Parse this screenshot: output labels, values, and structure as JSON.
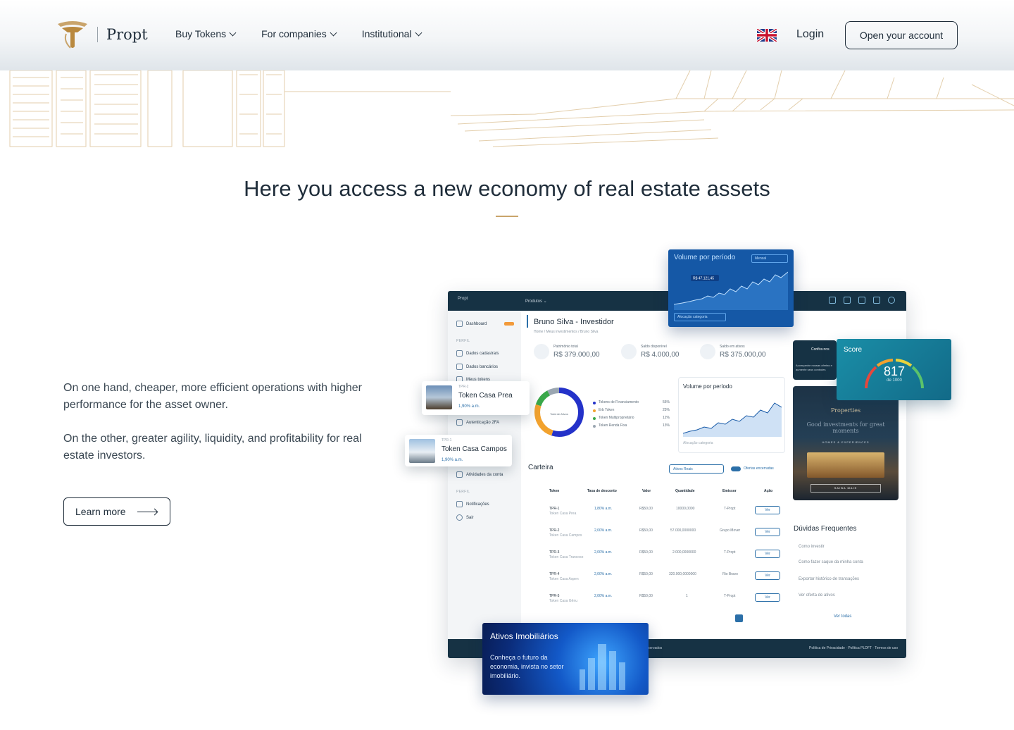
{
  "header": {
    "brand": "Propt",
    "nav": [
      {
        "label": "Buy Tokens"
      },
      {
        "label": "For companies"
      },
      {
        "label": "Institutional"
      }
    ],
    "language_icon": "uk-flag-icon",
    "login_label": "Login",
    "cta_label": "Open your account"
  },
  "hero": {
    "headline": "Here you access a new economy of real estate assets",
    "accent_color": "#c9a46b",
    "paragraph_1": "On one hand, cheaper, more efficient operations with higher performance for the asset owner.",
    "paragraph_2": "On the other, greater agility, liquidity, and profitability for real estate investors.",
    "learn_more_label": "Learn more"
  },
  "dashboard": {
    "topbar": {
      "brand": "Propt",
      "menu": "Produtos ⌄"
    },
    "sidebar": {
      "items_top": [
        {
          "label": "Dashboard"
        }
      ],
      "section_profile": "PERFIL",
      "items_profile": [
        {
          "label": "Dados cadastrais"
        },
        {
          "label": "Dados bancários"
        },
        {
          "label": "Meus tokens"
        },
        {
          "label": "Autenticação 2FA"
        },
        {
          "label": "Atividades da conta"
        }
      ],
      "section_profile_2": "PERFIL",
      "items_bottom": [
        {
          "label": "Notificações"
        },
        {
          "label": "Sair"
        }
      ]
    },
    "user_title": "Bruno Silva - Investidor",
    "breadcrumb": "Home / Meus investimentos / Bruno Silva",
    "kpis": [
      {
        "label": "Patrimônio total",
        "value": "R$ 379.000,00"
      },
      {
        "label": "Saldo disponível",
        "value": "R$ 4.000,00"
      },
      {
        "label": "Saldo em ativos",
        "value": "R$ 375.000,00"
      }
    ],
    "donut": {
      "center_label": "Total de Ativos",
      "legend": [
        {
          "name": "Tokens de Financiamento",
          "pct": "55%",
          "color": "#2432c9"
        },
        {
          "name": "Erb Token",
          "pct": "25%",
          "color": "#f2a22e"
        },
        {
          "name": "Token Multiproprietário",
          "pct": "12%",
          "color": "#3aa84a"
        },
        {
          "name": "Token Renda Fixa",
          "pct": "13%",
          "color": "#9aa6b1"
        }
      ]
    },
    "volume_card": {
      "title": "Volume por período",
      "filter": "Mensal",
      "category": "Alocação categoria"
    },
    "carteira": {
      "title": "Carteira",
      "filter": "Ativos Reais",
      "toggle_label": "Ofertas encerradas",
      "headers": [
        "Token",
        "Taxa de desconto",
        "Valor",
        "Quantidade",
        "Emissor",
        "Ação"
      ],
      "rows": [
        {
          "code": "TPR-1",
          "name": "Token Casa Prea",
          "rate": "1,80% a.m.",
          "value": "R$50,00",
          "qty": "10000,0000",
          "issuer": "T-Propt"
        },
        {
          "code": "TPR-2",
          "name": "Token Casa Campos",
          "rate": "2,00% a.m.",
          "value": "R$50,00",
          "qty": "57.000,0000000",
          "issuer": "Grupo Mover"
        },
        {
          "code": "TPR-3",
          "name": "Token Casa Trancoso",
          "rate": "2,00% a.m.",
          "value": "R$50,00",
          "qty": "2.000,0000000",
          "issuer": "T-Propt"
        },
        {
          "code": "TPR-4",
          "name": "Token Casa Aspen",
          "rate": "2,00% a.m.",
          "value": "R$50,00",
          "qty": "320.000,0000000",
          "issuer": "Rio Bravo"
        },
        {
          "code": "TPR-5",
          "name": "Token Casa Gênu",
          "rate": "2,00% a.m.",
          "value": "R$50,00",
          "qty": "1",
          "issuer": "T-Propt"
        }
      ],
      "action_label": "Ver"
    },
    "confira": {
      "title": "Confira nos",
      "body": "Acompanhe nossas ofertas e aumente seus controles"
    },
    "properties_card": {
      "title": "Properties",
      "subtitle": "Good investments for great moments",
      "tag": "HOMES & EXPERIENCES",
      "button": "SAIBA MAIS"
    },
    "faq": {
      "title": "Dúvidas Frequentes",
      "items": [
        {
          "label": "Como investir"
        },
        {
          "label": "Como fazer saque da minha conta"
        },
        {
          "label": "Exportar histórico de transações"
        },
        {
          "label": "Ver oferta de ativos"
        }
      ],
      "see_all": "Ver todas"
    },
    "footer": {
      "left": "servados",
      "links": "Política de Privacidade · Política PLDFT · Termos de uso"
    }
  },
  "floating": {
    "volume": {
      "title": "Volume por período",
      "filter": "Mensal",
      "category": "Alocação categoria",
      "tooltip": "R$ 47.121,45"
    },
    "score": {
      "title": "Score",
      "value": "817",
      "scale": "de 1000"
    },
    "token_1": {
      "code": "TPR-2",
      "name": "Token Casa Prea",
      "rate": "1,90% a.m."
    },
    "token_2": {
      "code": "TPR-1",
      "name": "Token Casa Campos",
      "rate": "1,90% a.m."
    },
    "ativos": {
      "title": "Ativos Imobiliários",
      "body": "Conheça o futuro da economia, invista no setor imobiliário."
    }
  }
}
